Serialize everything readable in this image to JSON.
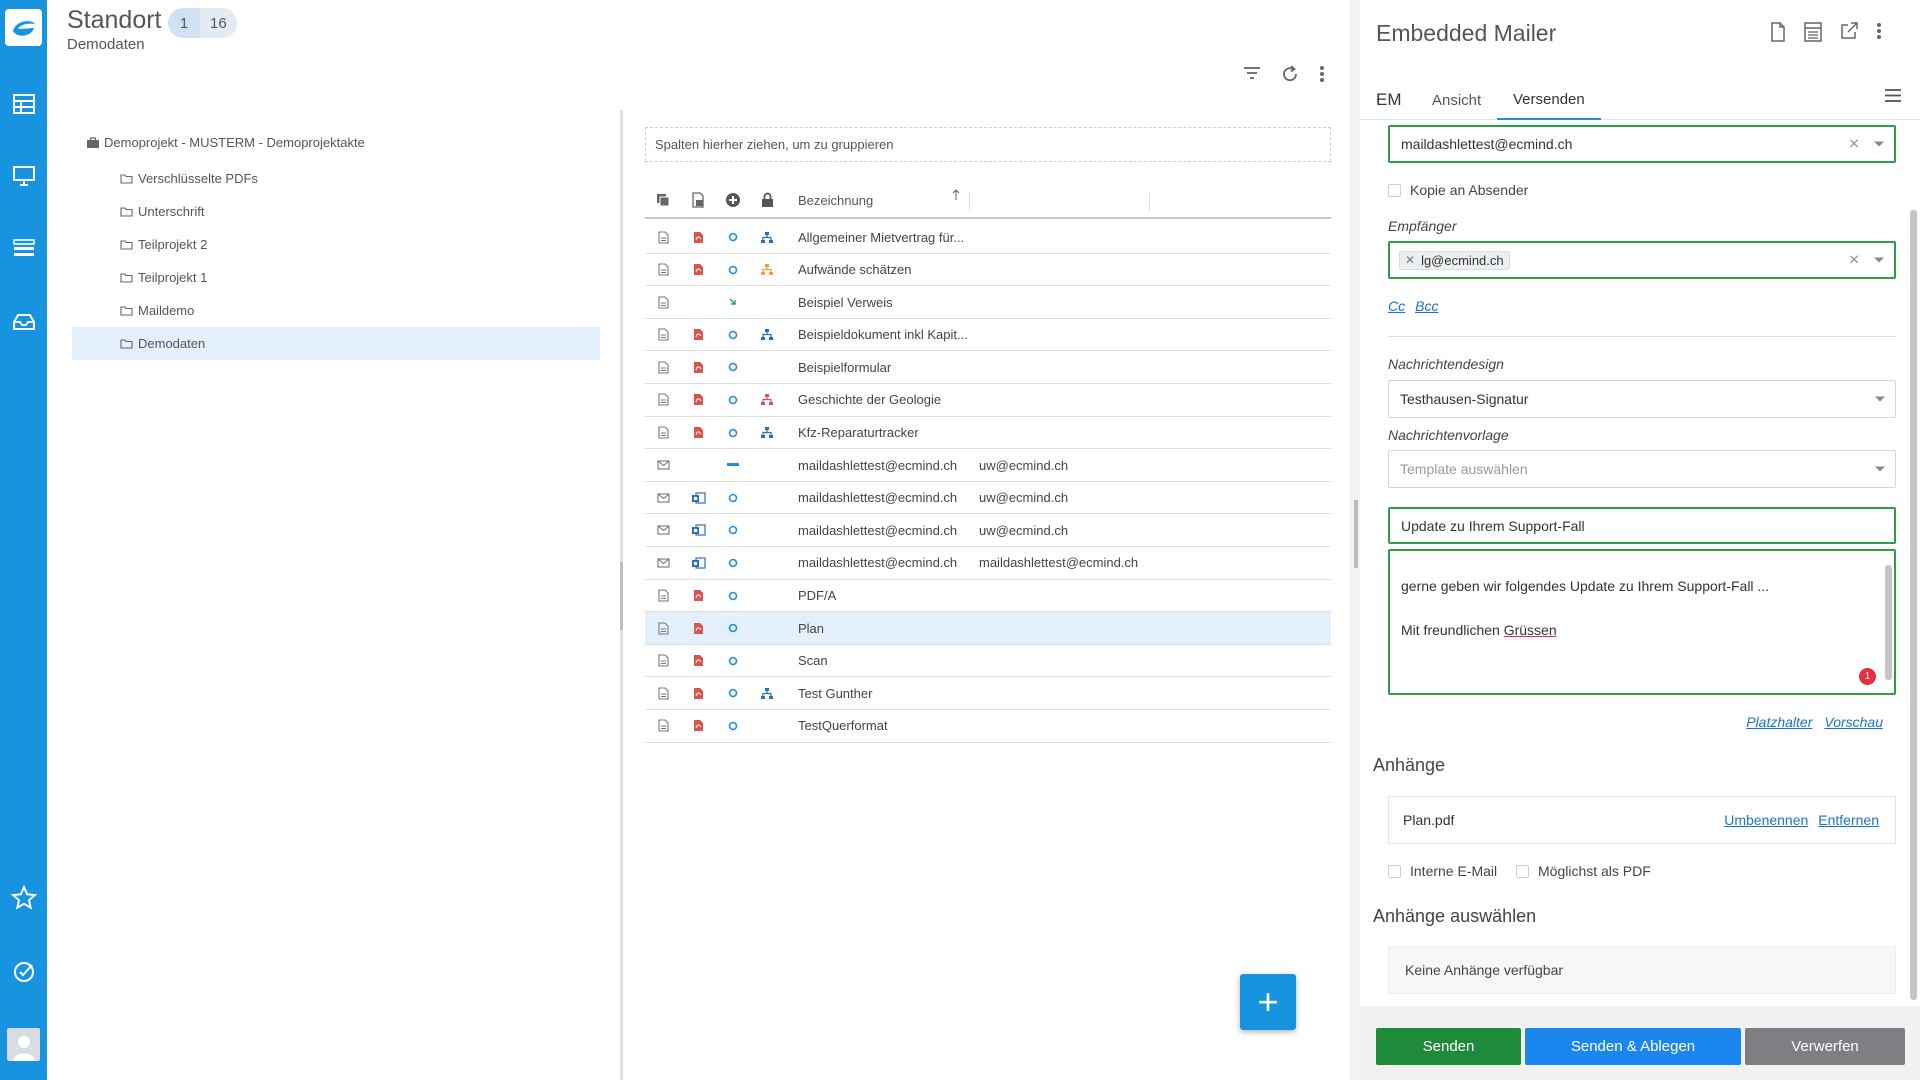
{
  "header": {
    "title": "Standort",
    "badge1": "1",
    "badge2": "16",
    "subtitle": "Demodaten"
  },
  "rail": {
    "icons": [
      "logo-icon",
      "grid-icon",
      "monitor-icon",
      "list-icon",
      "inbox-icon",
      "star-icon",
      "check-circle-icon",
      "user-avatar-icon"
    ],
    "accent": "#1793e0"
  },
  "tree": {
    "root": "Demoprojekt - MUSTERM - Demoprojektakte",
    "items": [
      {
        "label": "Verschlüsselte PDFs"
      },
      {
        "label": "Unterschrift"
      },
      {
        "label": "Teilprojekt 2"
      },
      {
        "label": "Teilprojekt 1"
      },
      {
        "label": "Maildemo"
      },
      {
        "label": "Demodaten"
      }
    ],
    "selected": "Demodaten"
  },
  "grid": {
    "group_placeholder": "Spalten hierher ziehen, um zu gruppieren",
    "column_header": "Bezeichnung",
    "rows": [
      {
        "type": "doc",
        "pdf": true,
        "status": "circle",
        "tree": "blue",
        "name": "Allgemeiner Mietvertrag für...",
        "extra": ""
      },
      {
        "type": "doc",
        "pdf": true,
        "status": "circle",
        "tree": "orange",
        "name": "Aufwände schätzen",
        "extra": ""
      },
      {
        "type": "doc",
        "pdf": false,
        "status": "arrow",
        "tree": "",
        "name": "Beispiel Verweis",
        "extra": ""
      },
      {
        "type": "doc",
        "pdf": true,
        "status": "circle",
        "tree": "blue",
        "name": "Beispieldokument inkl Kapit...",
        "extra": ""
      },
      {
        "type": "doc",
        "pdf": true,
        "status": "circle",
        "tree": "",
        "name": "Beispielformular",
        "extra": ""
      },
      {
        "type": "doc",
        "pdf": true,
        "status": "circle",
        "tree": "red",
        "name": "Geschichte der Geologie",
        "extra": ""
      },
      {
        "type": "doc",
        "pdf": true,
        "status": "circle",
        "tree": "blue",
        "name": "Kfz-Reparaturtracker",
        "extra": ""
      },
      {
        "type": "mail",
        "pdf": false,
        "status": "dash",
        "tree": "",
        "name": "maildashlettest@ecmind.ch",
        "extra": "uw@ecmind.ch"
      },
      {
        "type": "mail",
        "pdf": false,
        "outlook": true,
        "status": "circle",
        "tree": "",
        "name": "maildashlettest@ecmind.ch",
        "extra": "uw@ecmind.ch"
      },
      {
        "type": "mail",
        "pdf": false,
        "outlook": true,
        "status": "circle",
        "tree": "",
        "name": "maildashlettest@ecmind.ch",
        "extra": "uw@ecmind.ch"
      },
      {
        "type": "mail",
        "pdf": false,
        "outlook": true,
        "status": "circle",
        "tree": "",
        "name": "maildashlettest@ecmind.ch",
        "extra": "maildashlettest@ecmind.ch"
      },
      {
        "type": "doc",
        "pdf": true,
        "status": "circle",
        "tree": "",
        "name": "PDF/A",
        "extra": ""
      },
      {
        "type": "doc",
        "pdf": true,
        "status": "circle",
        "tree": "",
        "name": "Plan",
        "extra": "",
        "selected": true
      },
      {
        "type": "doc",
        "pdf": true,
        "status": "circle",
        "tree": "",
        "name": "Scan",
        "extra": ""
      },
      {
        "type": "doc",
        "pdf": true,
        "status": "circle",
        "tree": "blue",
        "name": "Test Gunther",
        "extra": ""
      },
      {
        "type": "doc",
        "pdf": true,
        "status": "circle",
        "tree": "",
        "name": "TestQuerformat",
        "extra": ""
      }
    ]
  },
  "fab": {
    "label": "+"
  },
  "mailer": {
    "title": "Embedded Mailer",
    "tabs": {
      "em": "EM",
      "view": "Ansicht",
      "send": "Versenden"
    },
    "from": "maildashlettest@ecmind.ch",
    "copy_to_sender": "Kopie an Absender",
    "recipients_label": "Empfänger",
    "recipient": "lg@ecmind.ch",
    "cc": "Cc",
    "bcc": "Bcc",
    "design_label": "Nachrichtendesign",
    "design_value": "Testhausen-Signatur",
    "template_label": "Nachrichtenvorlage",
    "template_placeholder": "Template auswählen",
    "subject": "Update zu Ihrem Support-Fall",
    "body_line1": "gerne geben wir folgendes Update zu Ihrem Support-Fall ...",
    "body_line2_prefix": "Mit freundlichen ",
    "body_line2_word": "Grüssen",
    "error_count": "1",
    "placeholder_link": "Platzhalter",
    "preview_link": "Vorschau",
    "attachments_title": "Anhänge",
    "attachment_name": "Plan.pdf",
    "rename": "Umbenennen",
    "remove": "Entfernen",
    "internal_email": "Interne E-Mail",
    "as_pdf": "Möglichst als PDF",
    "select_attachments_title": "Anhänge auswählen",
    "no_attachments": "Keine Anhänge verfügbar",
    "send": "Senden",
    "send_and_file": "Senden & Ablegen",
    "discard": "Verwerfen",
    "colors": {
      "send": "#1e8a3c",
      "send_file": "#1a86ee",
      "discard": "#7d7f82",
      "valid": "#2e9b4d"
    }
  }
}
